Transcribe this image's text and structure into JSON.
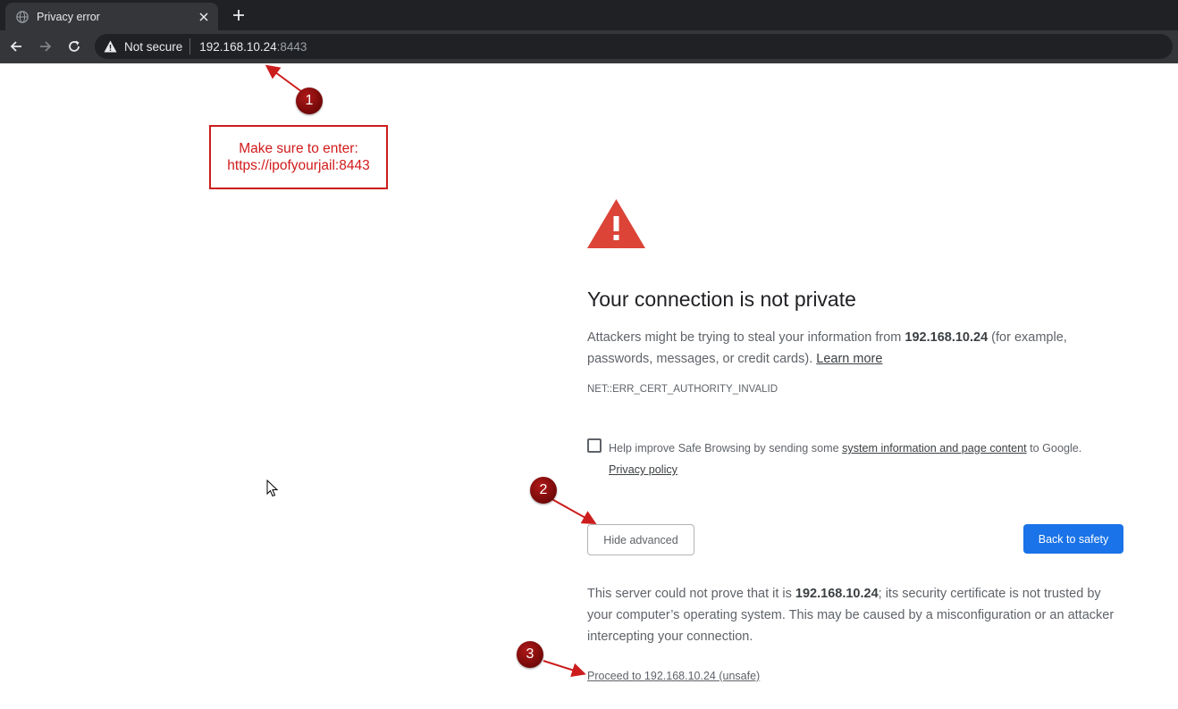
{
  "browser": {
    "tab_title": "Privacy error",
    "not_secure_label": "Not secure",
    "url_host": "192.168.10.24",
    "url_port": ":8443"
  },
  "annotations": {
    "badge_1": "1",
    "badge_2": "2",
    "badge_3": "3",
    "note_line1": "Make sure to enter:",
    "note_line2": "https://ipofyourjail:8443",
    "color": "#cc1d1d"
  },
  "interstitial": {
    "heading": "Your connection is not private",
    "intro_pre": "Attackers might be trying to steal your information from ",
    "host": "192.168.10.24",
    "intro_post": " (for example, passwords, messages, or credit cards). ",
    "learn_more": "Learn more",
    "error_code": "NET::ERR_CERT_AUTHORITY_INVALID",
    "safe_browsing_pre": "Help improve Safe Browsing by sending some ",
    "safe_browsing_link": "system information and page content",
    "safe_browsing_post": " to Google.",
    "privacy_policy": "Privacy policy",
    "hide_advanced": "Hide advanced",
    "back_to_safety": "Back to safety",
    "detail_pre": "This server could not prove that it is ",
    "detail_host": "192.168.10.24",
    "detail_post": "; its security certificate is not trusted by your computer’s operating system. This may be caused by a misconfiguration or an attacker intercepting your connection.",
    "proceed_link": "Proceed to 192.168.10.24 (unsafe)",
    "accent_color": "#1a73e8",
    "warning_color": "#db4437"
  }
}
